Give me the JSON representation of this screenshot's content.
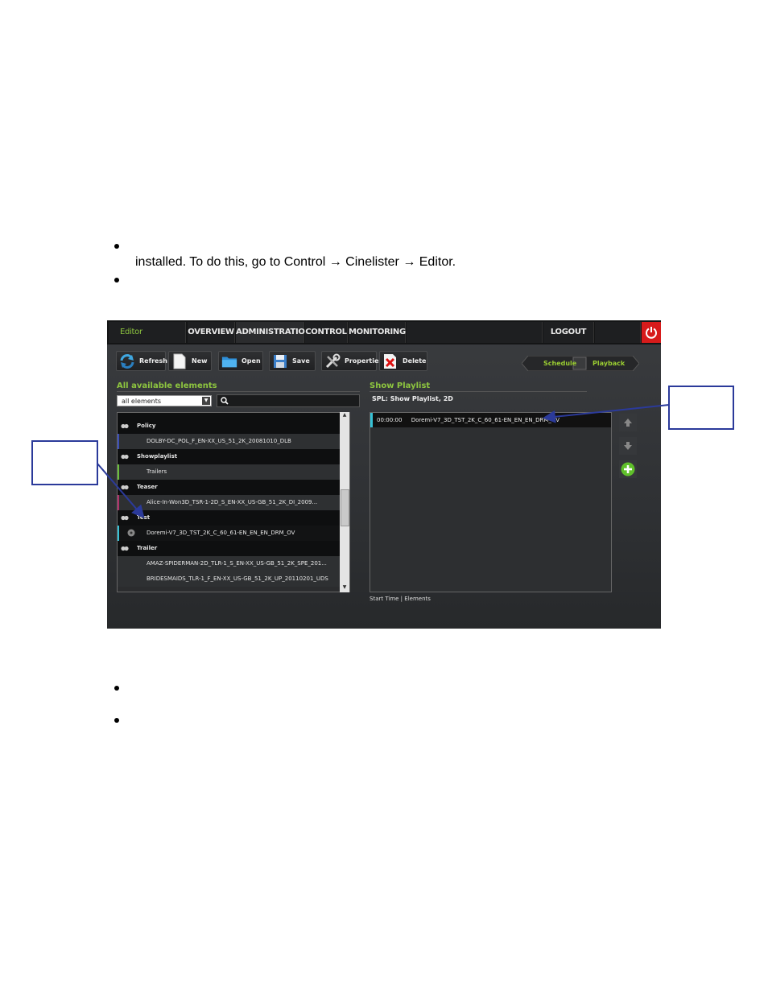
{
  "document": {
    "bullets": [
      "installed. To do this, go to Control → Cinelister → Editor."
    ]
  },
  "app": {
    "nav": {
      "editor": "Editor",
      "overview": "OVERVIEW",
      "administration": "ADMINISTRATION",
      "control": "CONTROL",
      "monitoring": "MONITORING",
      "logout": "LOGOUT"
    },
    "toolbar": {
      "refresh": "Refresh",
      "new": "New",
      "open": "Open",
      "save": "Save",
      "properties": "Properties",
      "delete": "Delete"
    },
    "mode": {
      "schedule": "Schedule",
      "playback": "Playback"
    },
    "left_panel": {
      "title": "All available elements",
      "filter": "all elements",
      "rows": [
        {
          "type": "category",
          "label": "Policy"
        },
        {
          "type": "item",
          "label": "DOLBY-DC_POL_F_EN-XX_US_51_2K_20081010_DLB",
          "accent": "#3a4db8"
        },
        {
          "type": "category",
          "label": "Showplaylist"
        },
        {
          "type": "item",
          "label": "Trailers",
          "accent": "#6abf3a"
        },
        {
          "type": "category",
          "label": "Teaser"
        },
        {
          "type": "item",
          "label": "Alice-In-Won3D_TSR-1-2D_S_EN-XX_US-GB_51_2K_DI_2009...",
          "accent": "#b0306a"
        },
        {
          "type": "category",
          "label": "Test"
        },
        {
          "type": "item-selected",
          "label": "Doremi-V7_3D_TST_2K_C_60_61-EN_EN_EN_DRM_OV",
          "accent": "#36c2d6"
        },
        {
          "type": "category",
          "label": "Trailer"
        },
        {
          "type": "item",
          "label": "AMAZ-SPIDERMAN-2D_TLR-1_S_EN-XX_US-GB_51_2K_SPE_201...",
          "accent": ""
        },
        {
          "type": "item",
          "label": "BRIDESMAIDS_TLR-1_F_EN-XX_US-GB_51_2K_UP_20110201_UDS",
          "accent": ""
        }
      ]
    },
    "right_panel": {
      "title": "Show Playlist",
      "spl": "SPL: Show Playlist, 2D",
      "rows": [
        {
          "time": "00:00:00",
          "name": "Doremi-V7_3D_TST_2K_C_60_61-EN_EN_EN_DRM_OV"
        }
      ],
      "footer": "Start Time | Elements"
    },
    "icons": {
      "refresh": "refresh-icon",
      "new": "new-document-icon",
      "open": "folder-icon",
      "save": "floppy-disk-icon",
      "properties": "tools-icon",
      "delete": "delete-x-icon",
      "power": "power-icon",
      "up": "arrow-up-icon",
      "down": "arrow-down-icon",
      "add": "add-icon",
      "search": "search-icon",
      "film": "film-reel-icon"
    },
    "colors": {
      "accent_green": "#8ec63f",
      "power_red": "#d71b1b",
      "callout_blue": "#2b3a9a",
      "selection_cyan": "#36c2d6"
    }
  }
}
